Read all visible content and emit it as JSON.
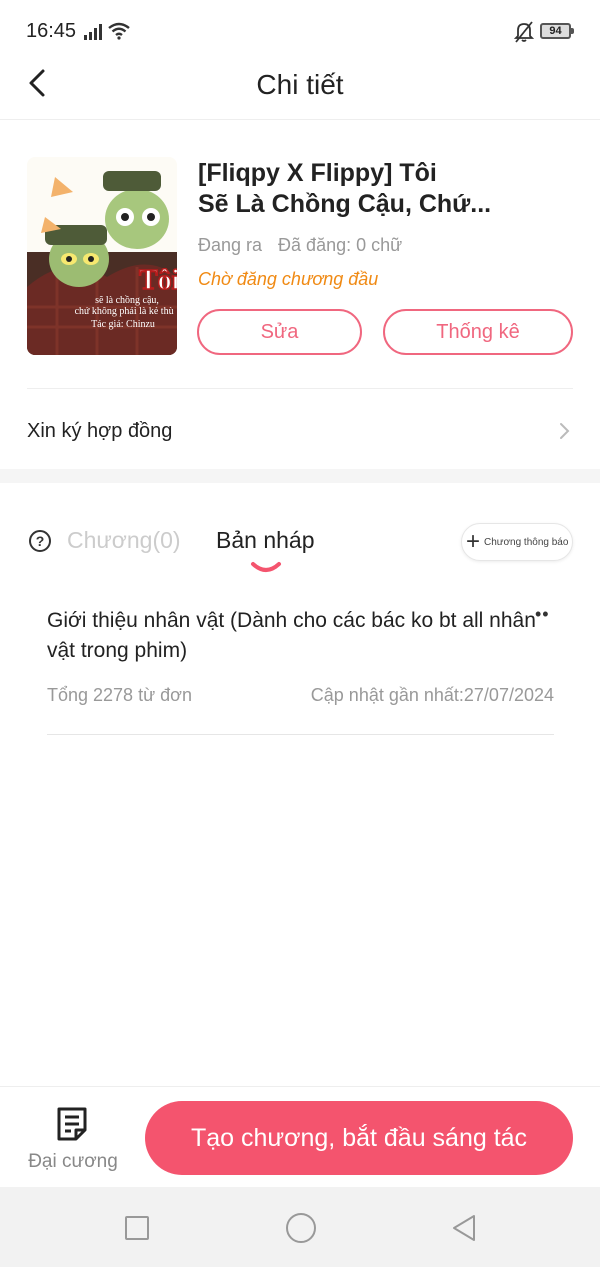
{
  "status": {
    "time": "16:45",
    "battery": "94"
  },
  "header": {
    "title": "Chi tiết"
  },
  "book": {
    "title_line1": "[Fliqpy X Flippy] Tôi",
    "title_line2": "Sẽ Là Chồng Cậu, Chứ...",
    "state": "Đang ra",
    "published": "Đã đăng: 0 chữ",
    "pending": "Chờ đăng chương đầu",
    "cover": {
      "big_text": "Tôi",
      "line1": "sẽ là chồng cậu,",
      "line2": "chứ không phải là kẻ thù !",
      "line3": "Tác giả: Chinzu"
    },
    "edit_label": "Sửa",
    "stats_label": "Thống kê"
  },
  "contract": {
    "label": "Xin ký hợp đồng"
  },
  "tabs": {
    "chapters": "Chương(0)",
    "drafts": "Bản nháp",
    "notice_button": "Chương thông báo",
    "active": "drafts"
  },
  "drafts": [
    {
      "title": "Giới thiệu nhân vật (Dành cho các bác ko bt all nhân vật trong phim)",
      "words": "Tổng 2278 từ đơn",
      "updated": "Cập nhật gần nhất:27/07/2024"
    }
  ],
  "bottom": {
    "outline_label": "Đại cương",
    "create_label": "Tạo chương, bắt đầu sáng tác"
  },
  "colors": {
    "accent": "#f4546e",
    "accent_outline": "#f0677f",
    "pending": "#f08a14"
  },
  "icons": [
    "signal-icon",
    "wifi-icon",
    "bell-off-icon",
    "battery-icon",
    "back-arrow-icon",
    "chevron-right-icon",
    "help-circle-icon",
    "plus-icon",
    "document-icon",
    "nav-square-icon",
    "nav-circle-icon",
    "nav-triangle-icon"
  ]
}
